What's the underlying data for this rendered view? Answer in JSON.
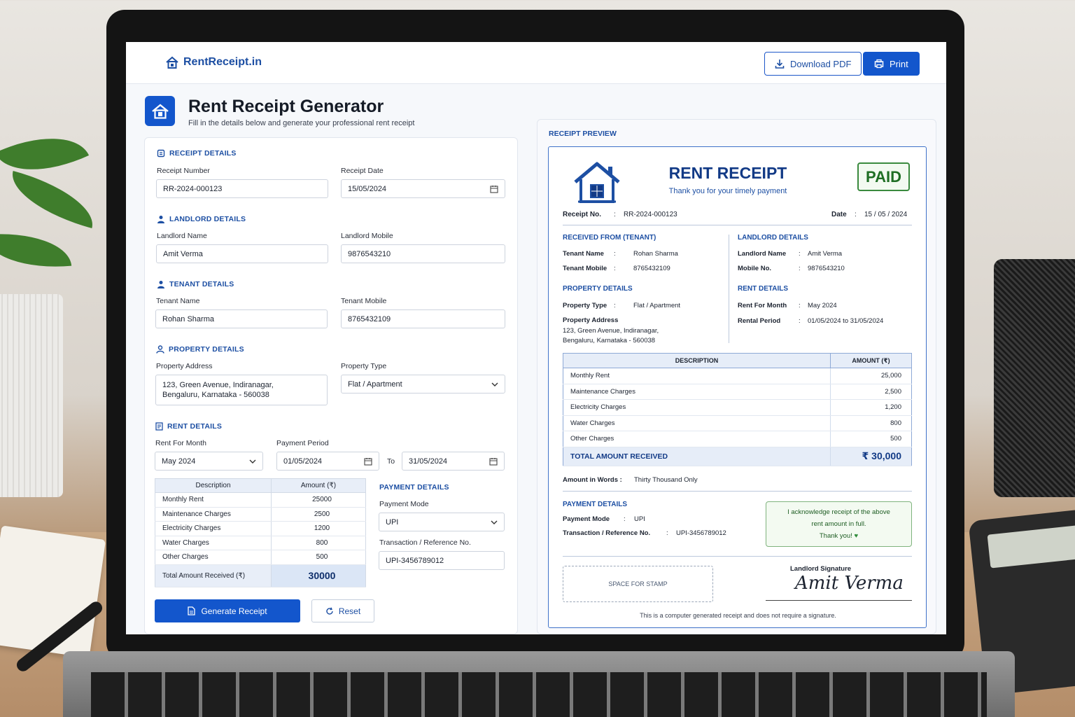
{
  "app": {
    "brand": "RentReceipt.in",
    "download_label": "Download PDF",
    "print_label": "Print"
  },
  "header": {
    "title": "Rent Receipt Generator",
    "subtitle": "Fill in the details below and generate your professional rent receipt"
  },
  "form": {
    "receipt_section": "RECEIPT DETAILS",
    "receipt_number_label": "Receipt Number",
    "receipt_number": "RR-2024-000123",
    "receipt_date_label": "Receipt Date",
    "receipt_date": "15/05/2024",
    "landlord_section": "LANDLORD DETAILS",
    "landlord_name_label": "Landlord Name",
    "landlord_name": "Amit Verma",
    "landlord_mobile_label": "Landlord Mobile",
    "landlord_mobile": "9876543210",
    "tenant_section": "TENANT DETAILS",
    "tenant_name_label": "Tenant Name",
    "tenant_name": "Rohan Sharma",
    "tenant_mobile_label": "Tenant Mobile",
    "tenant_mobile": "8765432109",
    "property_section": "PROPERTY DETAILS",
    "property_address_label": "Property Address",
    "property_address": "123, Green Avenue, Indiranagar,\nBengaluru, Karnataka - 560038",
    "property_type_label": "Property Type",
    "property_type": "Flat / Apartment",
    "rent_section": "RENT DETAILS",
    "rent_month_label": "Rent For Month",
    "rent_month": "May 2024",
    "payment_period_label": "Payment Period",
    "period_from": "01/05/2024",
    "to_label": "To",
    "period_to": "31/05/2024",
    "table": {
      "col_desc": "Description",
      "col_amount": "Amount (₹)",
      "rows": [
        {
          "desc": "Monthly Rent",
          "amount": "25000"
        },
        {
          "desc": "Maintenance Charges",
          "amount": "2500"
        },
        {
          "desc": "Electricity Charges",
          "amount": "1200"
        },
        {
          "desc": "Water Charges",
          "amount": "800"
        },
        {
          "desc": "Other Charges",
          "amount": "500"
        }
      ],
      "total_label": "Total Amount Received (₹)",
      "total": "30000"
    },
    "payment_section": "PAYMENT DETAILS",
    "payment_mode_label": "Payment Mode",
    "payment_mode": "UPI",
    "txn_label": "Transaction / Reference No.",
    "txn": "UPI-3456789012",
    "generate_label": "Generate Receipt",
    "reset_label": "Reset"
  },
  "preview": {
    "panel_title": "RECEIPT PREVIEW",
    "title": "RENT RECEIPT",
    "subtitle": "Thank you for your timely payment",
    "status": "PAID",
    "receipt_no_label": "Receipt No.",
    "receipt_no": "RR-2024-000123",
    "date_label": "Date",
    "date": "15 / 05 / 2024",
    "tenant_section": "RECEIVED FROM (TENANT)",
    "tenant_name_label": "Tenant Name",
    "tenant_name": "Rohan Sharma",
    "tenant_mobile_label": "Tenant Mobile",
    "tenant_mobile": "8765432109",
    "landlord_section": "LANDLORD DETAILS",
    "landlord_name_label": "Landlord Name",
    "landlord_name": "Amit Verma",
    "landlord_mobile_label": "Mobile No.",
    "landlord_mobile": "9876543210",
    "property_section": "PROPERTY DETAILS",
    "property_type_label": "Property Type",
    "property_type": "Flat / Apartment",
    "property_address_label": "Property Address",
    "property_address_1": "123, Green Avenue, Indiranagar,",
    "property_address_2": "Bengaluru, Karnataka - 560038",
    "rent_section": "RENT DETAILS",
    "rent_month_label": "Rent For Month",
    "rent_month": "May 2024",
    "rental_period_label": "Rental Period",
    "rental_period": "01/05/2024 to 31/05/2024",
    "table": {
      "col_desc": "DESCRIPTION",
      "col_amount": "AMOUNT (₹)",
      "rows": [
        {
          "desc": "Monthly Rent",
          "amount": "25,000"
        },
        {
          "desc": "Maintenance Charges",
          "amount": "2,500"
        },
        {
          "desc": "Electricity Charges",
          "amount": "1,200"
        },
        {
          "desc": "Water Charges",
          "amount": "800"
        },
        {
          "desc": "Other Charges",
          "amount": "500"
        }
      ],
      "total_label": "TOTAL AMOUNT RECEIVED",
      "total": "₹ 30,000"
    },
    "words_label": "Amount in Words :",
    "words": "Thirty Thousand Only",
    "payment_section": "PAYMENT DETAILS",
    "payment_mode_label": "Payment Mode",
    "payment_mode": "UPI",
    "txn_label": "Transaction / Reference No.",
    "txn": "UPI-3456789012",
    "ack_line1": "I acknowledge receipt of the above",
    "ack_line2": "rent amount in full.",
    "ack_line3": "Thank you!",
    "stamp": "SPACE FOR STAMP",
    "signature_label": "Landlord Signature",
    "signature": "Amit Verma",
    "footer": "This is a computer generated receipt and does not require a signature."
  },
  "colors": {
    "accent": "#1356cc",
    "paid_green": "#1f6e24"
  }
}
